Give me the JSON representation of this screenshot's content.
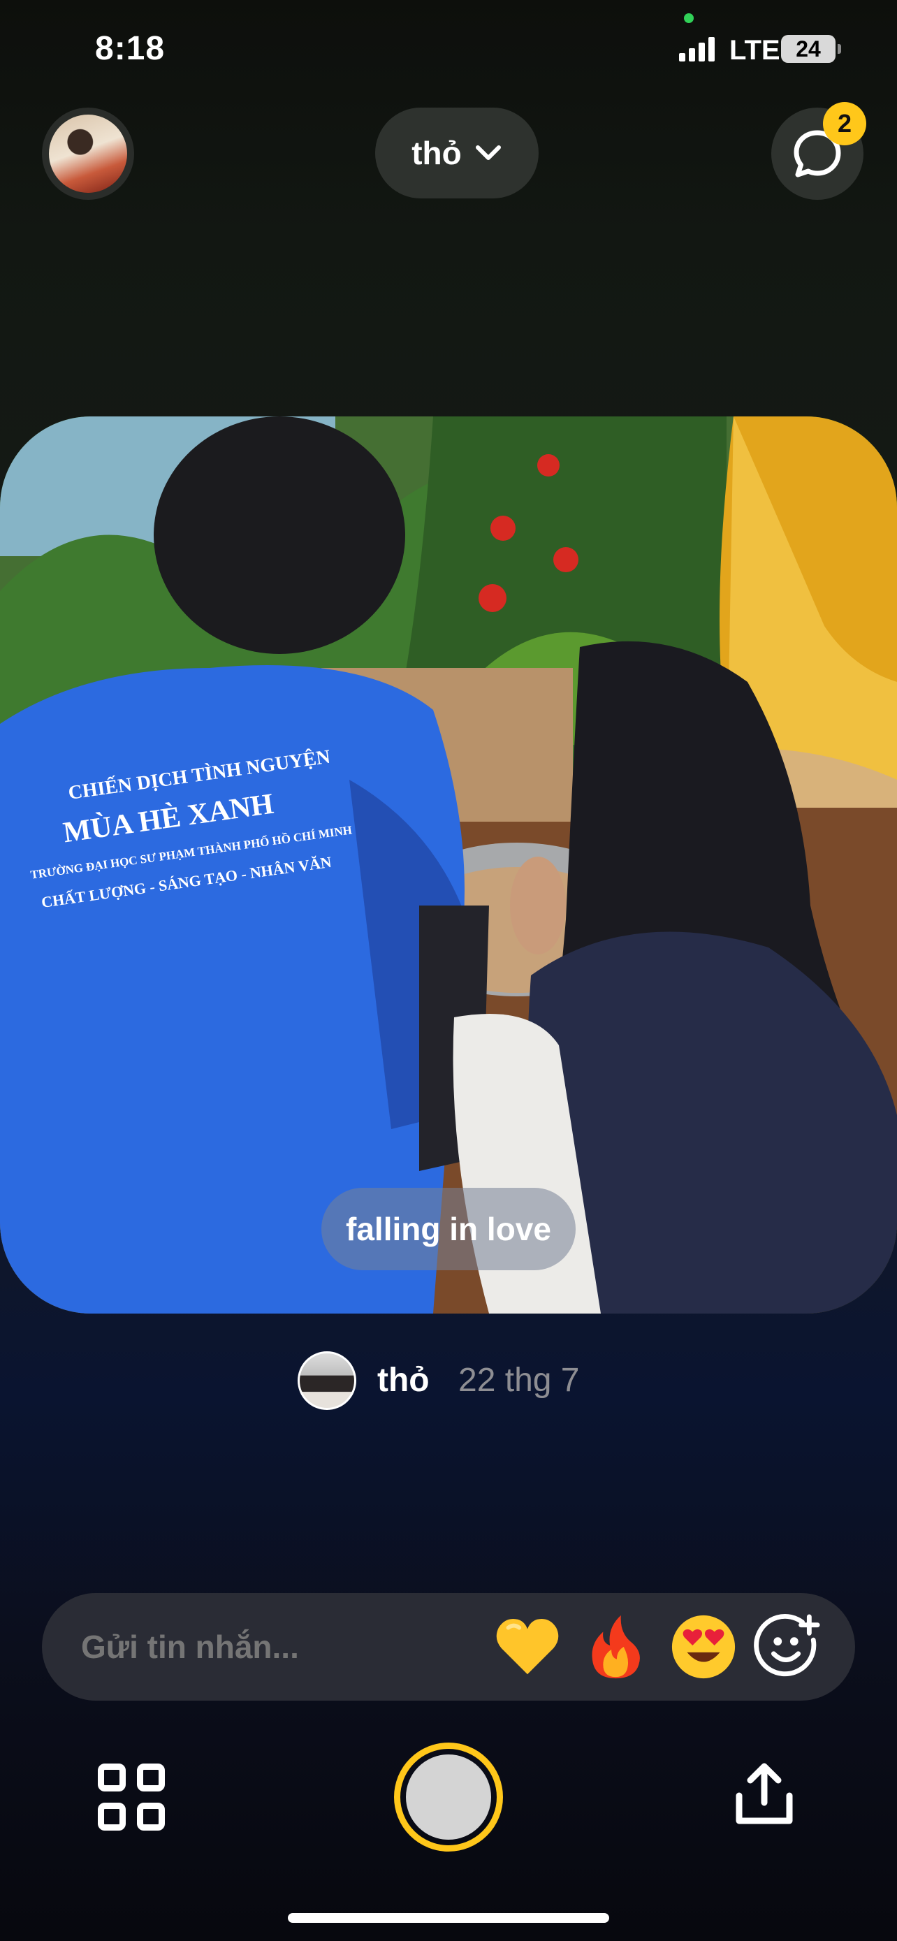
{
  "status_bar": {
    "time": "8:18",
    "network": "LTE",
    "battery": "24"
  },
  "header": {
    "friend_filter": "thỏ",
    "chat_badge_count": "2"
  },
  "post": {
    "caption": "falling in love",
    "author": "thỏ",
    "date": "22 thg 7",
    "shirt_text": [
      "CHIẾN DỊCH TÌNH NGUYỆN",
      "MÙA HÈ XANH",
      "TRƯỜNG ĐẠI HỌC SƯ PHẠM THÀNH PHỐ HỒ CHÍ MINH",
      "CHẤT LƯỢNG - SÁNG TẠO - NHÂN VĂN"
    ]
  },
  "message_bar": {
    "placeholder": "Gửi tin nhắn...",
    "reactions": [
      "yellow-heart",
      "fire",
      "heart-eyes"
    ]
  },
  "colors": {
    "accent": "#ffc71a",
    "badge": "#ffc71a",
    "pill_bg": "#2e322e"
  }
}
